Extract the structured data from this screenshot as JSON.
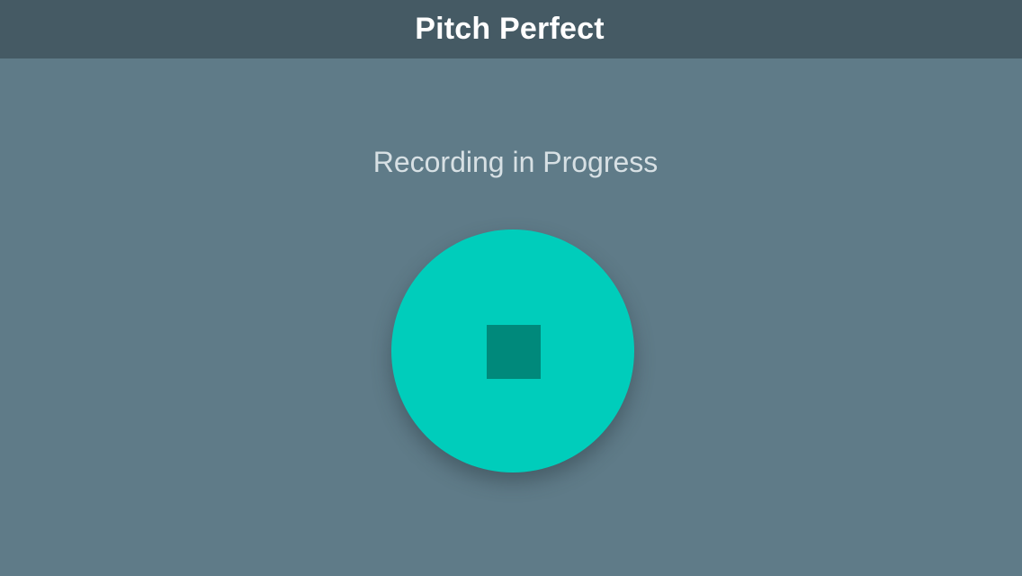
{
  "nav": {
    "title": "Pitch Perfect"
  },
  "main": {
    "status_text": "Recording in Progress",
    "stop_button": {
      "icon": "stop-icon"
    }
  },
  "colors": {
    "background": "#5f7b88",
    "nav_bar": "#455a64",
    "button": "#00cdbb",
    "stop_square": "#00897b",
    "status_text": "#d7e0e4"
  }
}
